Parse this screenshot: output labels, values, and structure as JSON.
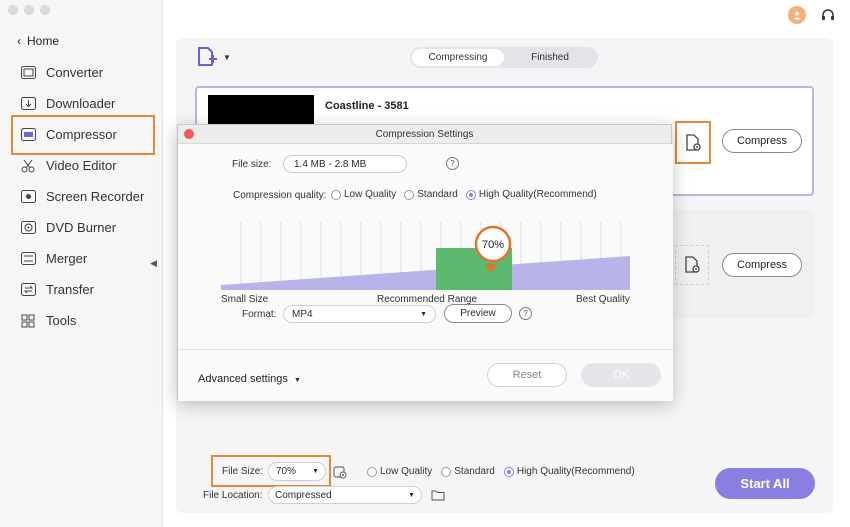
{
  "sidebar": {
    "home_label": "Home",
    "items": [
      {
        "label": "Converter",
        "icon": "converter-icon"
      },
      {
        "label": "Downloader",
        "icon": "downloader-icon"
      },
      {
        "label": "Compressor",
        "icon": "compressor-icon"
      },
      {
        "label": "Video Editor",
        "icon": "scissors-icon"
      },
      {
        "label": "Screen Recorder",
        "icon": "screen-recorder-icon"
      },
      {
        "label": "DVD Burner",
        "icon": "dvd-icon"
      },
      {
        "label": "Merger",
        "icon": "merger-icon"
      },
      {
        "label": "Transfer",
        "icon": "transfer-icon"
      },
      {
        "label": "Tools",
        "icon": "tools-icon"
      }
    ]
  },
  "tabs": {
    "compressing": "Compressing",
    "finished": "Finished"
  },
  "files": [
    {
      "name": "Coastline - 3581",
      "compress_label": "Compress"
    },
    {
      "name": "",
      "compress_label": "Compress"
    }
  ],
  "dialog": {
    "title": "Compression Settings",
    "file_size_label": "File size:",
    "file_size_value": "1.4 MB - 2.8 MB",
    "quality_label": "Compression quality:",
    "quality_options": [
      "Low Quality",
      "Standard",
      "High Quality(Recommend)"
    ],
    "quality_selected": "High Quality(Recommend)",
    "slider_value": "70%",
    "slider_fraction": 0.7,
    "small_size": "Small Size",
    "recommended_range": "Recommended Range",
    "best_quality": "Best Quality",
    "format_label": "Format:",
    "format_value": "MP4",
    "preview_label": "Preview",
    "advanced_label": "Advanced settings",
    "reset_label": "Reset",
    "ok_label": "OK"
  },
  "bottom": {
    "file_size_label": "File Size:",
    "file_size_value": "70%",
    "quality_options": [
      "Low Quality",
      "Standard",
      "High Quality(Recommend)"
    ],
    "quality_selected": "High Quality(Recommend)",
    "file_location_label": "File Location:",
    "file_location_value": "Compressed",
    "start_all_label": "Start  All"
  },
  "colors": {
    "accent": "#8a7fe0",
    "highlight": "#e08a3c",
    "recommend": "#5cba6e"
  }
}
